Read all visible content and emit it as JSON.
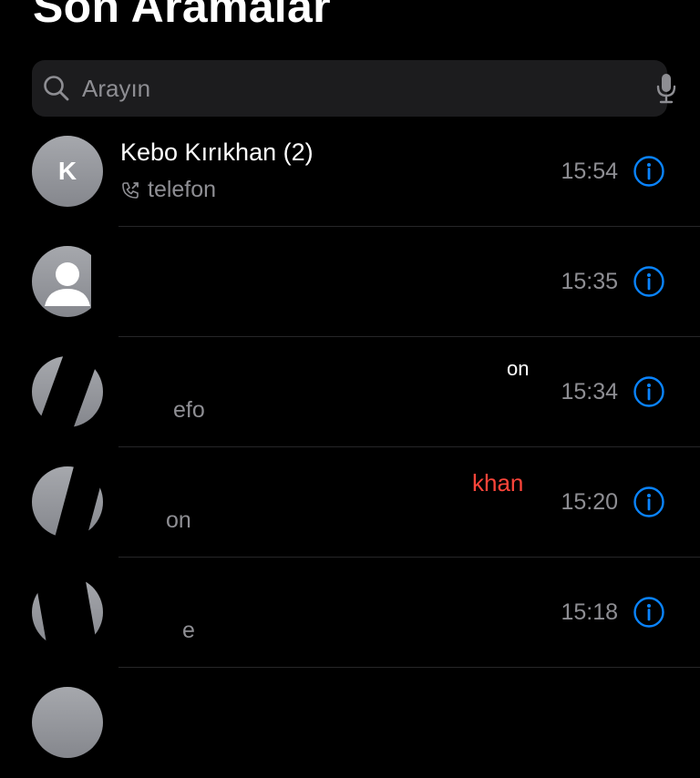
{
  "header": {
    "title": "Son Aramalar"
  },
  "search": {
    "placeholder": "Arayın",
    "value": ""
  },
  "colors": {
    "accent": "#0a84ff",
    "missed": "#ff453a",
    "secondary": "#8e8e93"
  },
  "calls": [
    {
      "initial": "K",
      "name": "Kebo Kırıkhan (2)",
      "type": "telefon",
      "time": "15:54",
      "missed": false
    },
    {
      "initial": "",
      "name": "",
      "type": "",
      "time": "15:35",
      "missed": false
    },
    {
      "initial": "",
      "name": "on",
      "type": "efo",
      "time": "15:34",
      "missed": false
    },
    {
      "initial": "",
      "name": "khan",
      "type": "on",
      "time": "15:20",
      "missed": true
    },
    {
      "initial": "",
      "name": "",
      "type": "e",
      "time": "15:18",
      "missed": false
    }
  ]
}
